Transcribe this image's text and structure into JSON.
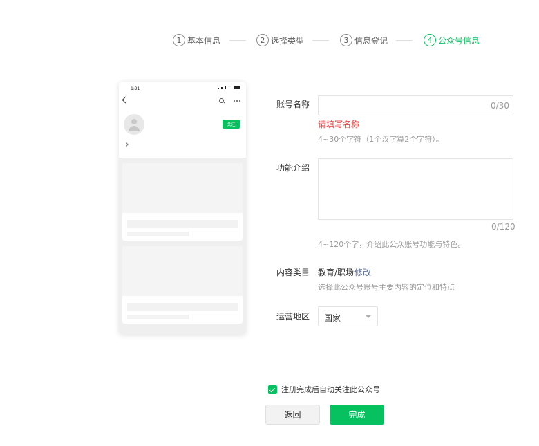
{
  "steps": [
    {
      "num": "1",
      "label": "基本信息"
    },
    {
      "num": "2",
      "label": "选择类型"
    },
    {
      "num": "3",
      "label": "信息登记"
    },
    {
      "num": "4",
      "label": "公众号信息"
    }
  ],
  "preview": {
    "time": "1:21",
    "follow_label": "关注"
  },
  "form": {
    "account_name": {
      "label": "账号名称",
      "value": "",
      "counter": "0/30",
      "error": "请填写名称",
      "hint": "4~30个字符（1个汉字算2个字符）。"
    },
    "intro": {
      "label": "功能介绍",
      "value": "",
      "counter": "0/120",
      "hint": "4~120个字，介绍此公众账号功能与特色。"
    },
    "category": {
      "label": "内容类目",
      "value": "教育/职场",
      "edit_label": "修改",
      "hint": "选择此公众号账号主要内容的定位和特点"
    },
    "region": {
      "label": "运营地区",
      "selected": "国家"
    }
  },
  "footer": {
    "auto_follow_label": "注册完成后自动关注此公众号",
    "auto_follow_checked": true,
    "back_label": "返回",
    "done_label": "完成"
  },
  "colors": {
    "accent": "#07c160",
    "error": "#e64340",
    "link": "#576b95"
  }
}
